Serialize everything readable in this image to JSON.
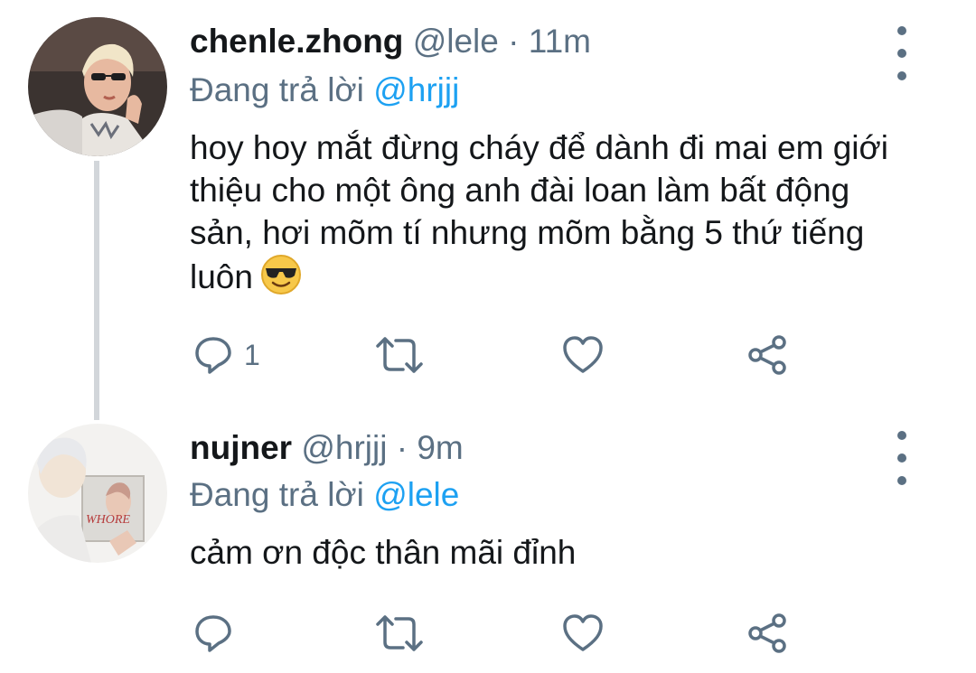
{
  "tweets": [
    {
      "name": "chenle.zhong",
      "handle": "@lele",
      "separator": "·",
      "time": "11m",
      "replying_prefix": "Đang trả lời",
      "replying_to": "@hrjjj",
      "text": "hoy hoy mắt đừng cháy để dành đi mai em giới thiệu cho một ông anh đài loan làm bất động sản, hơi mõm tí nhưng mõm bằng 5 thứ tiếng luôn",
      "emoji": "smiling-face-with-sunglasses",
      "reply_count": "1",
      "avatar_icon": "avatar-photo-blond-sunglasses"
    },
    {
      "name": "nujner",
      "handle": "@hrjjj",
      "separator": "·",
      "time": "9m",
      "replying_prefix": "Đang trả lời",
      "replying_to": "@lele",
      "text": "cảm ơn độc thân mãi đỉnh",
      "reply_count": "",
      "avatar_icon": "avatar-photo-mirror-whore"
    }
  ],
  "colors": {
    "primary_text": "#14171a",
    "secondary_text": "#5b7083",
    "link": "#1da1f2",
    "thread_line": "#d2d6da"
  },
  "icons": [
    "reply-icon",
    "retweet-icon",
    "like-icon",
    "share-icon",
    "more-options-icon"
  ]
}
